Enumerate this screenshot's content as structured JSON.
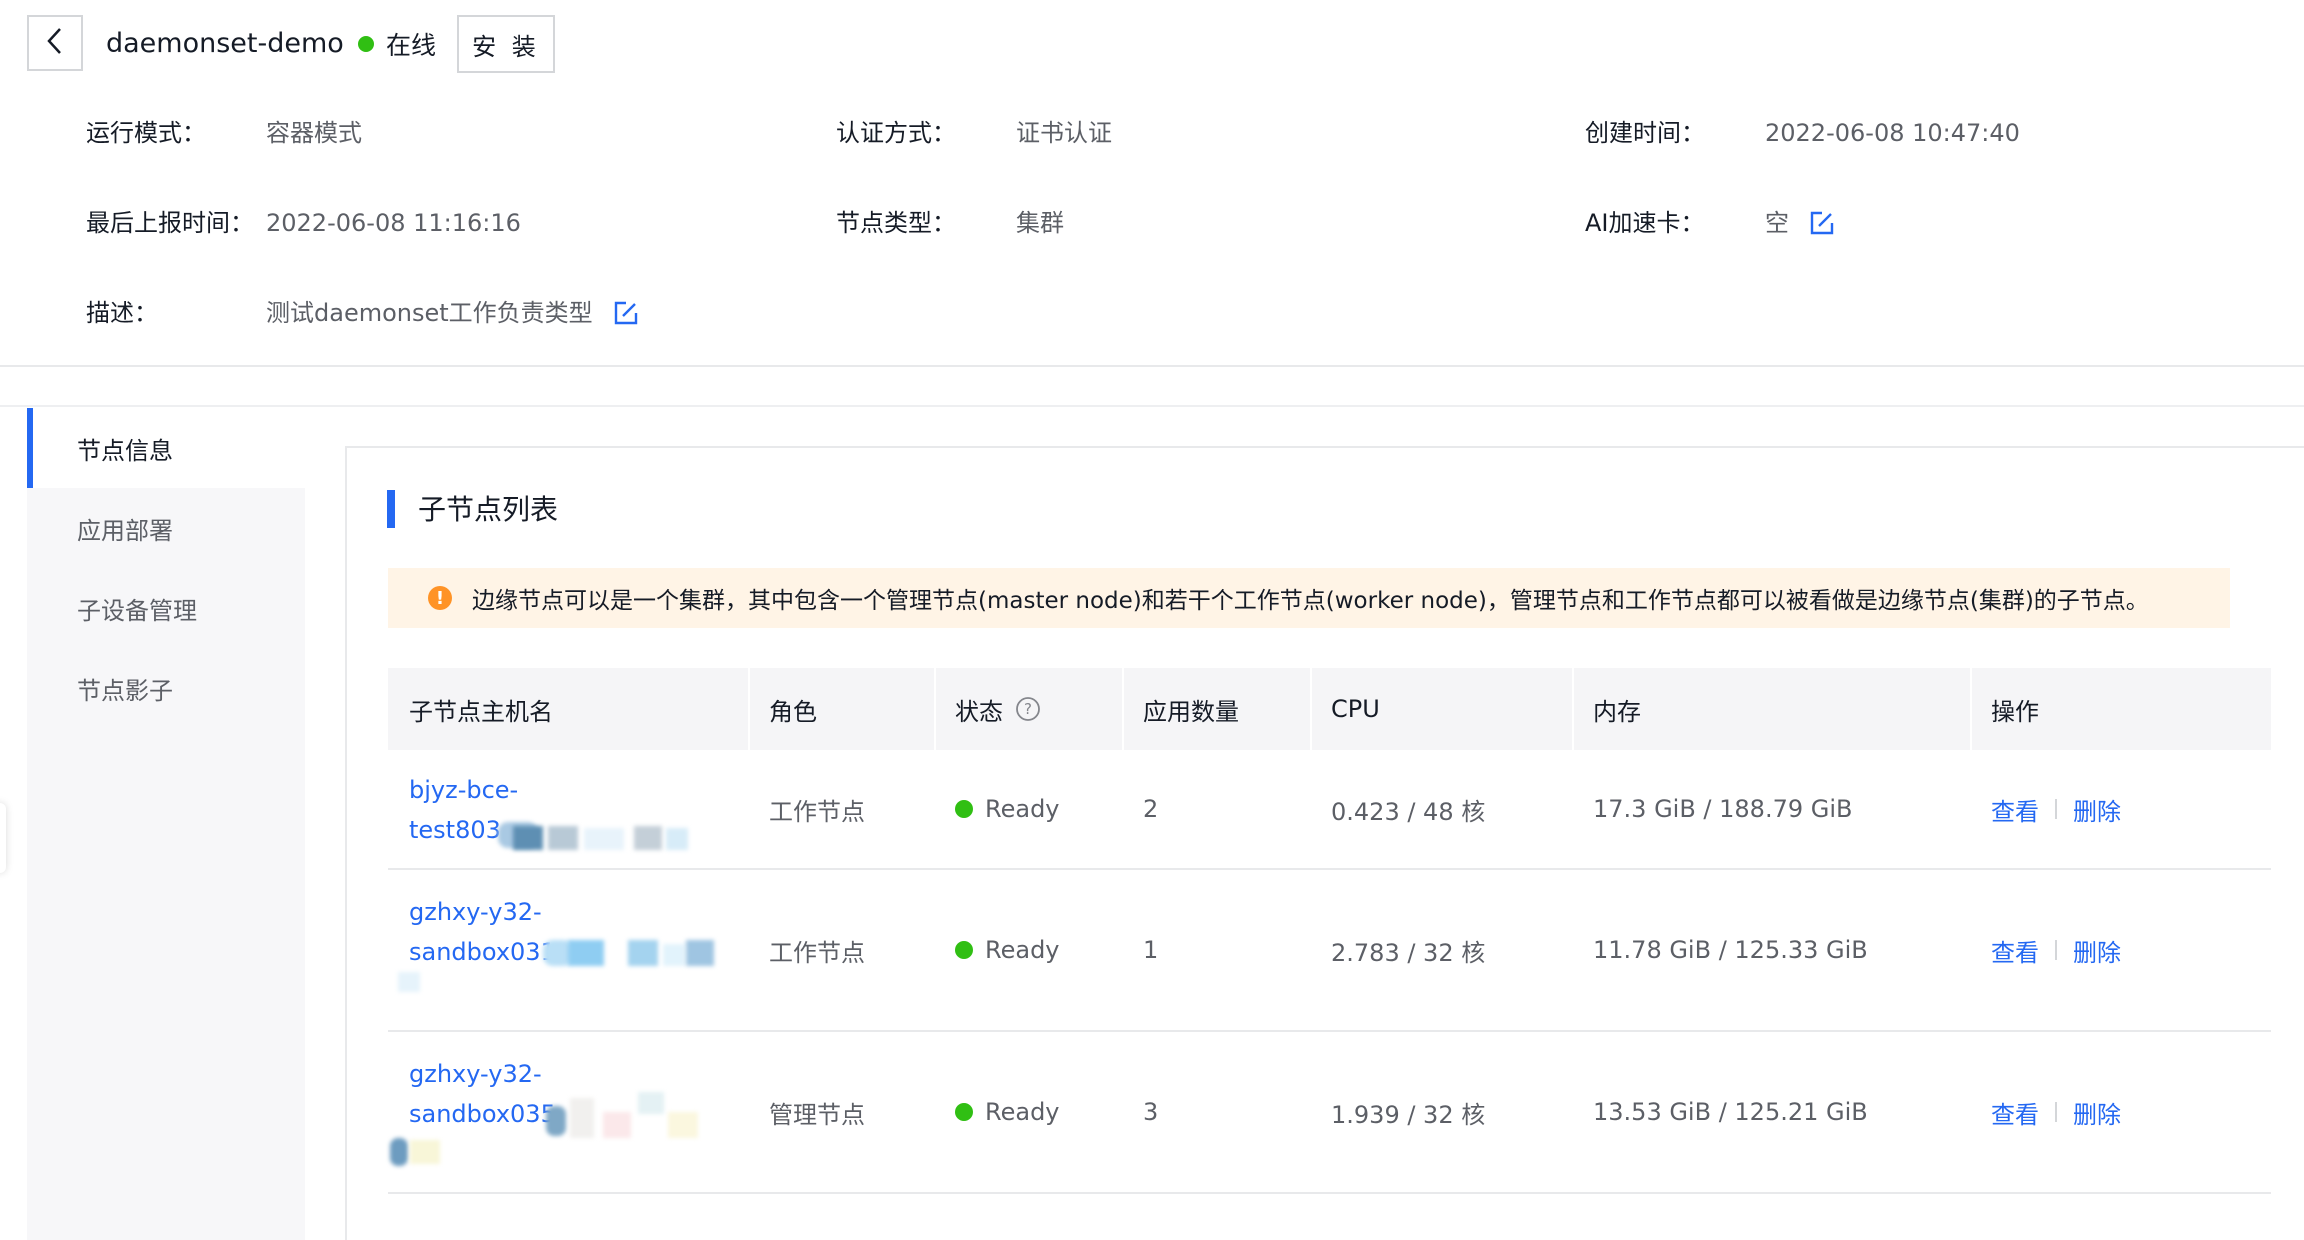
{
  "header": {
    "title": "daemonset-demo",
    "status": "在线",
    "install_label": "安 装",
    "colors": {
      "online": "#30bf13",
      "accent": "#2468f2"
    }
  },
  "info": {
    "run_mode_label": "运行模式：",
    "run_mode_value": "容器模式",
    "auth_label": "认证方式：",
    "auth_value": "证书认证",
    "created_label": "创建时间：",
    "created_value": "2022-06-08 10:47:40",
    "last_report_label": "最后上报时间：",
    "last_report_value": "2022-06-08 11:16:16",
    "node_type_label": "节点类型：",
    "node_type_value": "集群",
    "ai_label": "AI加速卡：",
    "ai_value": "空",
    "desc_label": "描述：",
    "desc_value": "测试daemonset工作负责类型"
  },
  "sidebar": {
    "items": [
      {
        "label": "节点信息",
        "active": true
      },
      {
        "label": "应用部署",
        "active": false
      },
      {
        "label": "子设备管理",
        "active": false
      },
      {
        "label": "节点影子",
        "active": false
      }
    ]
  },
  "section": {
    "title": "子节点列表"
  },
  "alert": {
    "icon": "warning-icon",
    "text": "边缘节点可以是一个集群，其中包含一个管理节点(master node)和若干个工作节点(worker node)，管理节点和工作节点都可以被看做是边缘节点(集群)的子节点。"
  },
  "table": {
    "columns": [
      "子节点主机名",
      "角色",
      "状态",
      "应用数量",
      "CPU",
      "内存",
      "操作"
    ],
    "rows": [
      {
        "host_line1": "bjyz-bce-",
        "host_line2": "test803",
        "role": "工作节点",
        "status": "Ready",
        "apps": "2",
        "cpu": "0.423 / 48 核",
        "memory": "17.3 GiB / 188.79 GiB",
        "view": "查看",
        "delete": "删除"
      },
      {
        "host_line1": "gzhxy-y32-",
        "host_line2": "sandbox031",
        "role": "工作节点",
        "status": "Ready",
        "apps": "1",
        "cpu": "2.783 / 32 核",
        "memory": "11.78 GiB / 125.33 GiB",
        "view": "查看",
        "delete": "删除"
      },
      {
        "host_line1": "gzhxy-y32-",
        "host_line2": "sandbox035",
        "role": "管理节点",
        "status": "Ready",
        "apps": "3",
        "cpu": "1.939 / 32 核",
        "memory": "13.53 GiB / 125.21 GiB",
        "view": "查看",
        "delete": "删除"
      }
    ]
  }
}
